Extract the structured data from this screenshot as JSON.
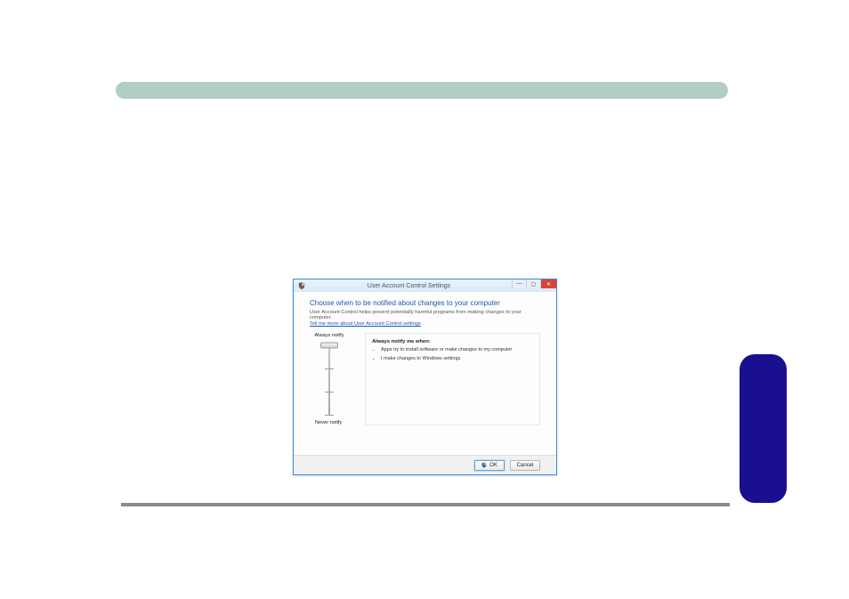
{
  "uac": {
    "window_title": "User Account Control Settings",
    "heading": "Choose when to be notified about changes to your computer",
    "subtext": "User Account Control helps prevent potentially harmful programs from making changes to your computer.",
    "link": "Tell me more about User Account Control settings",
    "slider": {
      "top_label": "Always notify",
      "bottom_label": "Never notify",
      "levels": 4,
      "position": 0
    },
    "desc": {
      "title": "Always notify me when:",
      "bullets": [
        "Apps try to install software or make changes to my computer",
        "I make changes to Windows settings"
      ]
    },
    "buttons": {
      "ok": "OK",
      "cancel": "Cancel"
    }
  }
}
